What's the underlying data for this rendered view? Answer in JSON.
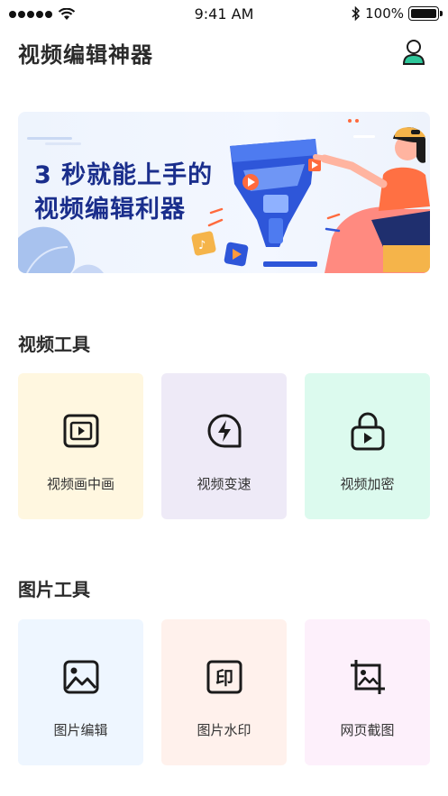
{
  "status_bar": {
    "time": "9:41 AM",
    "battery": "100%"
  },
  "header": {
    "title": "视频编辑神器"
  },
  "banner": {
    "line1": "3 秒就能上手的",
    "line2": "视频编辑利器"
  },
  "video_tools": {
    "title": "视频工具",
    "items": [
      {
        "label": "视频画中画",
        "icon": "picture-in-picture-icon",
        "bg": "#fff7e0"
      },
      {
        "label": "视频变速",
        "icon": "speed-icon",
        "bg": "#eeeaf7"
      },
      {
        "label": "视频加密",
        "icon": "lock-icon",
        "bg": "#dcfaee"
      }
    ]
  },
  "image_tools": {
    "title": "图片工具",
    "items": [
      {
        "label": "图片编辑",
        "icon": "image-icon",
        "bg": "#eef6ff"
      },
      {
        "label": "图片水印",
        "icon": "watermark-icon",
        "bg": "#fff1ec"
      },
      {
        "label": "网页截图",
        "icon": "screenshot-icon",
        "bg": "#fdf0fb"
      }
    ]
  }
}
